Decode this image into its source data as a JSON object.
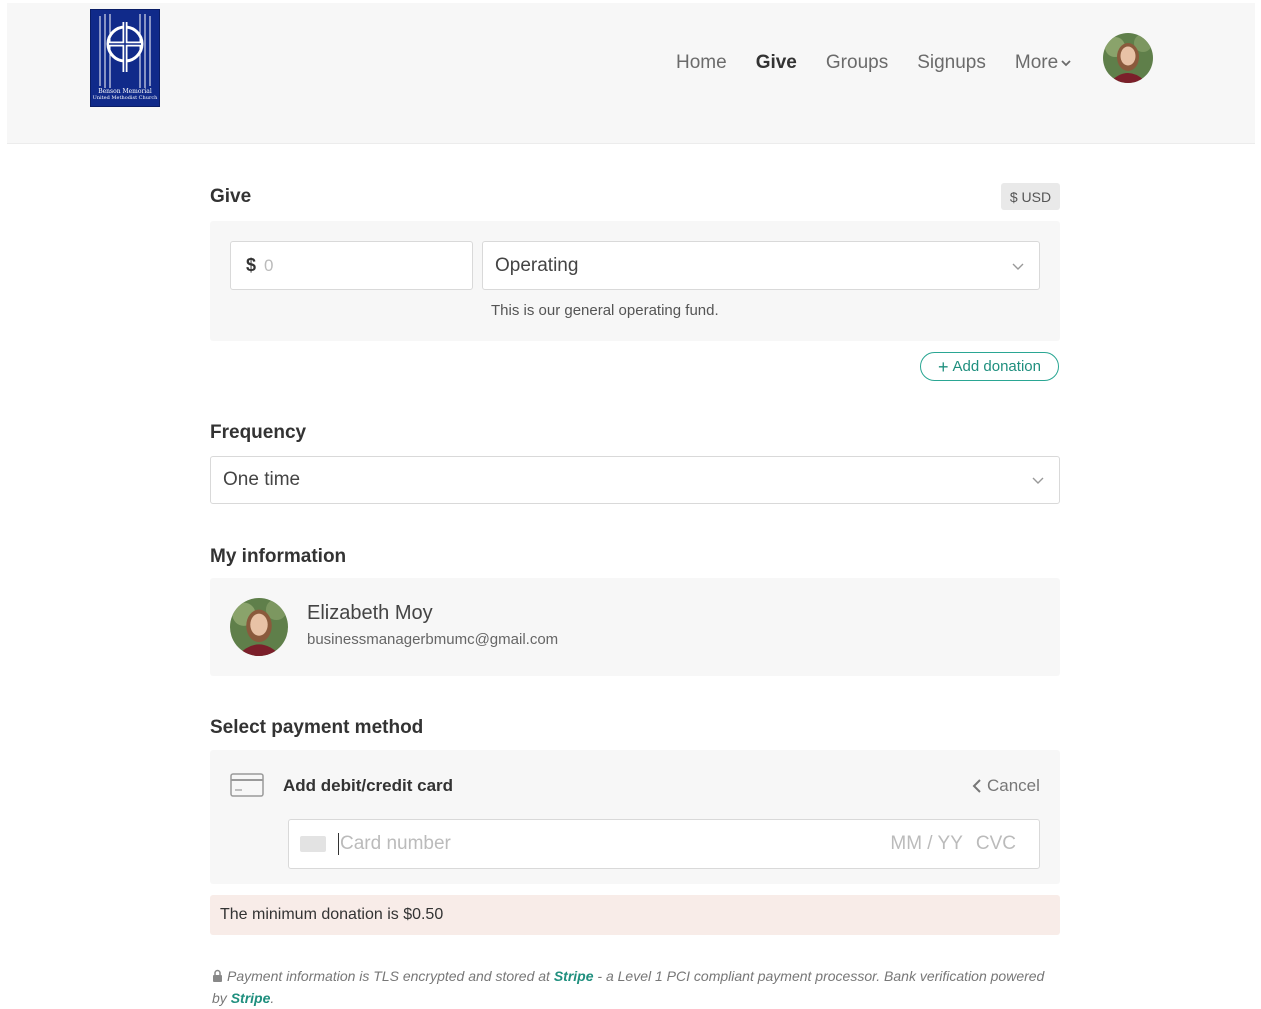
{
  "header": {
    "logo_name": "Benson Memorial",
    "logo_subtitle": "United Methodist Church",
    "nav": [
      {
        "label": "Home",
        "active": false
      },
      {
        "label": "Give",
        "active": true
      },
      {
        "label": "Groups",
        "active": false
      },
      {
        "label": "Signups",
        "active": false
      },
      {
        "label": "More",
        "active": false
      }
    ]
  },
  "give": {
    "title": "Give",
    "currency_badge": "$ USD",
    "amount_prefix": "$",
    "amount_placeholder": "0",
    "fund_selected": "Operating",
    "fund_description": "This is our general operating fund.",
    "add_donation_label": "Add donation"
  },
  "frequency": {
    "title": "Frequency",
    "selected": "One time"
  },
  "my_information": {
    "title": "My information",
    "name": "Elizabeth Moy",
    "email": "businessmanagerbmumc@gmail.com"
  },
  "payment": {
    "title": "Select payment method",
    "add_card_label": "Add debit/credit card",
    "cancel_label": "Cancel",
    "card_number_placeholder": "Card number",
    "expiry_placeholder": "MM / YY",
    "cvc_placeholder": "CVC"
  },
  "error_message": "The minimum donation is $0.50",
  "footer": {
    "text_1": "Payment information is TLS encrypted and stored at ",
    "stripe_1": "Stripe",
    "text_2": " - a Level 1 PCI compliant payment processor. Bank verification powered by ",
    "stripe_2": "Stripe",
    "text_3": "."
  },
  "colors": {
    "accent": "#1f8f7e",
    "logo_blue": "#102a8a",
    "panel_bg": "#f7f7f7",
    "error_bg": "#f8ece8"
  }
}
